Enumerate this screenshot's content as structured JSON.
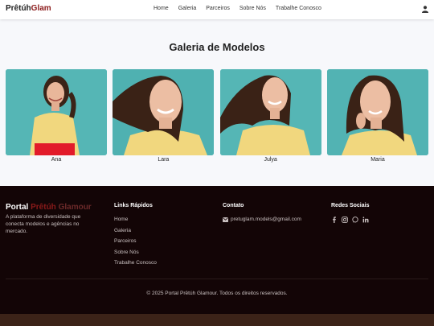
{
  "header": {
    "logo_main": "Prêtúh",
    "logo_accent": "Glam",
    "nav": [
      "Home",
      "Galeria",
      "Parceiros",
      "Sobre Nós",
      "Trabalhe Conosco"
    ],
    "user_icon": "user-icon"
  },
  "gallery": {
    "title": "Galeria de Modelos",
    "models": [
      {
        "name": "Ana"
      },
      {
        "name": "Lara"
      },
      {
        "name": "Julya"
      },
      {
        "name": "Maria"
      }
    ]
  },
  "footer": {
    "brand_1": "Portal ",
    "brand_2": "Prêtúh",
    "brand_3": " Glamour",
    "description": "A plataforma de diversidade que conecta modelos e agências no mercado.",
    "links_title": "Links Rápidos",
    "links": [
      "Home",
      "Galeria",
      "Parceiros",
      "Sobre Nós",
      "Trabalhe Conosco"
    ],
    "contact_title": "Contato",
    "contact_email": "pretuglam.models@gmail.com",
    "social_title": "Redes Sociais",
    "social_icons": [
      "facebook-icon",
      "instagram-icon",
      "whatsapp-icon",
      "linkedin-icon"
    ],
    "copyright": "© 2025 Portal Prêtúh Glamour. Todos os direitos reservados."
  },
  "colors": {
    "brand_red": "#8b1a1a",
    "footer_bg": "#130506",
    "photo_bg": "#52b3b3"
  }
}
